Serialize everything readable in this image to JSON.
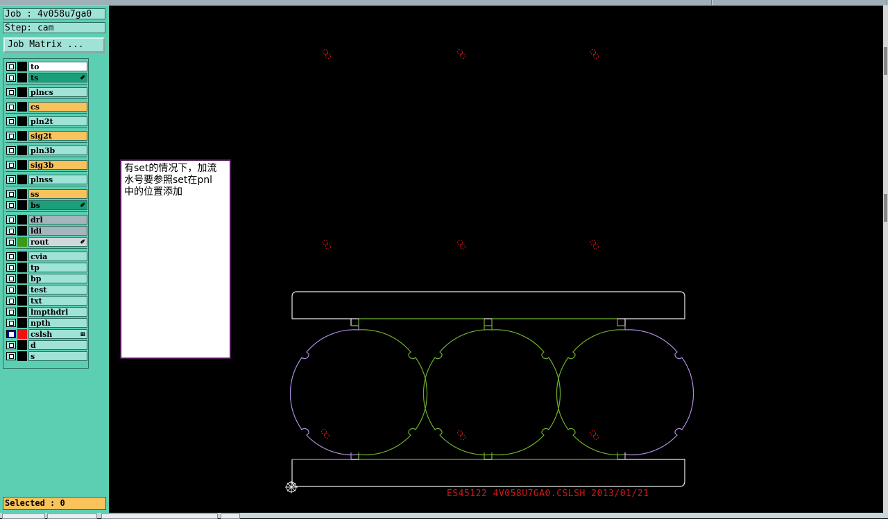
{
  "job": {
    "label": "Job : 4v058u7ga0"
  },
  "step": {
    "label": "Step: cam"
  },
  "matrix_button": "Job Matrix ...",
  "layers": [
    {
      "name": "to",
      "color": "#ffffff",
      "swatch": "#000000",
      "mark": "",
      "selected": false
    },
    {
      "name": "ts",
      "color": "#1aa078",
      "swatch": "#000000",
      "mark": "✐",
      "selected": false
    },
    {
      "name": "plncs",
      "color": "#9fe2d6",
      "swatch": "#000000",
      "mark": "",
      "selected": false
    },
    {
      "name": "cs",
      "color": "#f9c25a",
      "swatch": "#000000",
      "mark": "",
      "selected": false
    },
    {
      "name": "pln2t",
      "color": "#9fe2d6",
      "swatch": "#000000",
      "mark": "",
      "selected": false
    },
    {
      "name": "sig2t",
      "color": "#f9c25a",
      "swatch": "#000000",
      "mark": "",
      "selected": false
    },
    {
      "name": "pln3b",
      "color": "#9fe2d6",
      "swatch": "#000000",
      "mark": "",
      "selected": false
    },
    {
      "name": "sig3b",
      "color": "#f9c25a",
      "swatch": "#000000",
      "mark": "",
      "selected": false
    },
    {
      "name": "plnss",
      "color": "#9fe2d6",
      "swatch": "#000000",
      "mark": "",
      "selected": false
    },
    {
      "name": "ss",
      "color": "#f9c25a",
      "swatch": "#000000",
      "mark": "",
      "selected": false
    },
    {
      "name": "bs",
      "color": "#1aa078",
      "swatch": "#000000",
      "mark": "✐",
      "selected": false
    },
    {
      "name": "drl",
      "color": "#a6b4bc",
      "swatch": "#000000",
      "mark": "",
      "selected": false
    },
    {
      "name": "ldi",
      "color": "#a6b4bc",
      "swatch": "#000000",
      "mark": "",
      "selected": false
    },
    {
      "name": "rout",
      "color": "#d2d8da",
      "swatch": "#3a9a14",
      "mark": "✐",
      "selected": false
    },
    {
      "name": "cvia",
      "color": "#9fe2d6",
      "swatch": "#000000",
      "mark": "",
      "selected": false
    },
    {
      "name": "tp",
      "color": "#9fe2d6",
      "swatch": "#000000",
      "mark": "",
      "selected": false
    },
    {
      "name": "bp",
      "color": "#9fe2d6",
      "swatch": "#000000",
      "mark": "",
      "selected": false
    },
    {
      "name": "test",
      "color": "#9fe2d6",
      "swatch": "#000000",
      "mark": "",
      "selected": false
    },
    {
      "name": "txt",
      "color": "#9fe2d6",
      "swatch": "#000000",
      "mark": "",
      "selected": false
    },
    {
      "name": "lmpthdrl",
      "color": "#9fe2d6",
      "swatch": "#000000",
      "mark": "",
      "selected": false
    },
    {
      "name": "npth",
      "color": "#9fe2d6",
      "swatch": "#000000",
      "mark": "",
      "selected": false
    },
    {
      "name": "cslsh",
      "color": "#9fe2d6",
      "swatch": "#ee1111",
      "mark": "⊞",
      "selected": true
    },
    {
      "name": "d",
      "color": "#9fe2d6",
      "swatch": "#000000",
      "mark": "",
      "selected": false
    },
    {
      "name": "s",
      "color": "#9fe2d6",
      "swatch": "#000000",
      "mark": "",
      "selected": false
    }
  ],
  "selected_status": "Selected : 0",
  "note": {
    "line1": "有set的情况下，加流",
    "line2": "水号要参照set在pnl",
    "line3": "中的位置添加"
  },
  "canvas": {
    "stamp_text": "ES45122 4V058U7GA0.CSLSH 2013/01/21",
    "colors": {
      "outline_white": "#e8e8e8",
      "outline_purple": "#b08de0",
      "outline_green": "#6fb02a",
      "marks_red": "#d01818"
    }
  }
}
